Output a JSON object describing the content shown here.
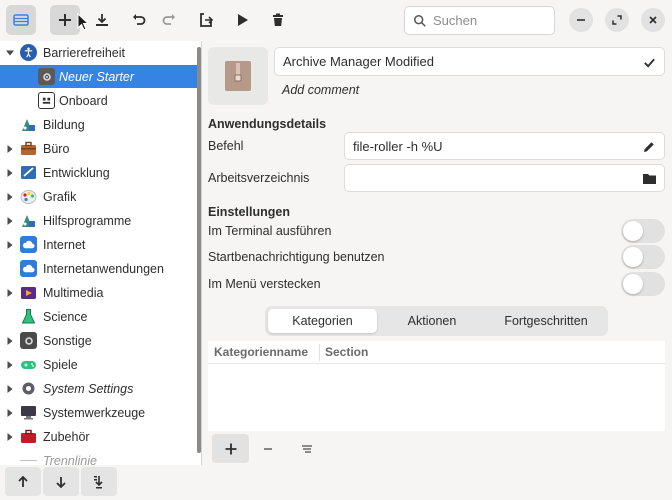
{
  "toolbar": {
    "buttons": [
      {
        "name": "sidebar-toggle-icon"
      },
      {
        "name": "add-icon"
      },
      {
        "name": "download-icon"
      },
      {
        "name": "undo-icon"
      },
      {
        "name": "redo-icon"
      },
      {
        "name": "export-icon"
      },
      {
        "name": "play-icon"
      },
      {
        "name": "delete-icon"
      }
    ],
    "search_placeholder": "Suchen"
  },
  "sidebar": {
    "items": [
      {
        "label": "Barrierefreiheit",
        "expanded": true,
        "italic": false
      },
      {
        "label": "Neuer Starter",
        "italic": true,
        "selected": true
      },
      {
        "label": "Onboard",
        "italic": false
      },
      {
        "label": "Bildung",
        "italic": false
      },
      {
        "label": "Büro",
        "italic": false
      },
      {
        "label": "Entwicklung",
        "italic": false
      },
      {
        "label": "Grafik",
        "italic": false
      },
      {
        "label": "Hilfsprogramme",
        "italic": false
      },
      {
        "label": "Internet",
        "italic": false
      },
      {
        "label": "Internetanwendungen",
        "italic": false
      },
      {
        "label": "Multimedia",
        "italic": false
      },
      {
        "label": "Science",
        "italic": false
      },
      {
        "label": "Sonstige",
        "italic": false
      },
      {
        "label": "Spiele",
        "italic": false
      },
      {
        "label": "System Settings",
        "italic": true
      },
      {
        "label": "Systemwerkzeuge",
        "italic": false
      },
      {
        "label": "Zubehör",
        "italic": false
      },
      {
        "label": "Trennlinie",
        "italic": true
      }
    ]
  },
  "launcher": {
    "name": "Archive Manager Modified",
    "comment_placeholder": "Add comment"
  },
  "details": {
    "title": "Anwendungsdetails",
    "command_label": "Befehl",
    "command_value": "file-roller -h %U",
    "workdir_label": "Arbeitsverzeichnis",
    "workdir_value": ""
  },
  "settings": {
    "title": "Einstellungen",
    "terminal_label": "Im Terminal ausführen",
    "startup_notify_label": "Startbenachrichtigung benutzen",
    "hide_menu_label": "Im Menü verstecken",
    "terminal_on": false,
    "startup_notify_on": false,
    "hide_menu_on": false
  },
  "tabs": [
    "Kategorien",
    "Aktionen",
    "Fortgeschritten"
  ],
  "table": {
    "columns": [
      "Kategorienname",
      "Section"
    ]
  },
  "colors": {
    "accent": "#3584e4",
    "background": "#f6f5f4"
  }
}
